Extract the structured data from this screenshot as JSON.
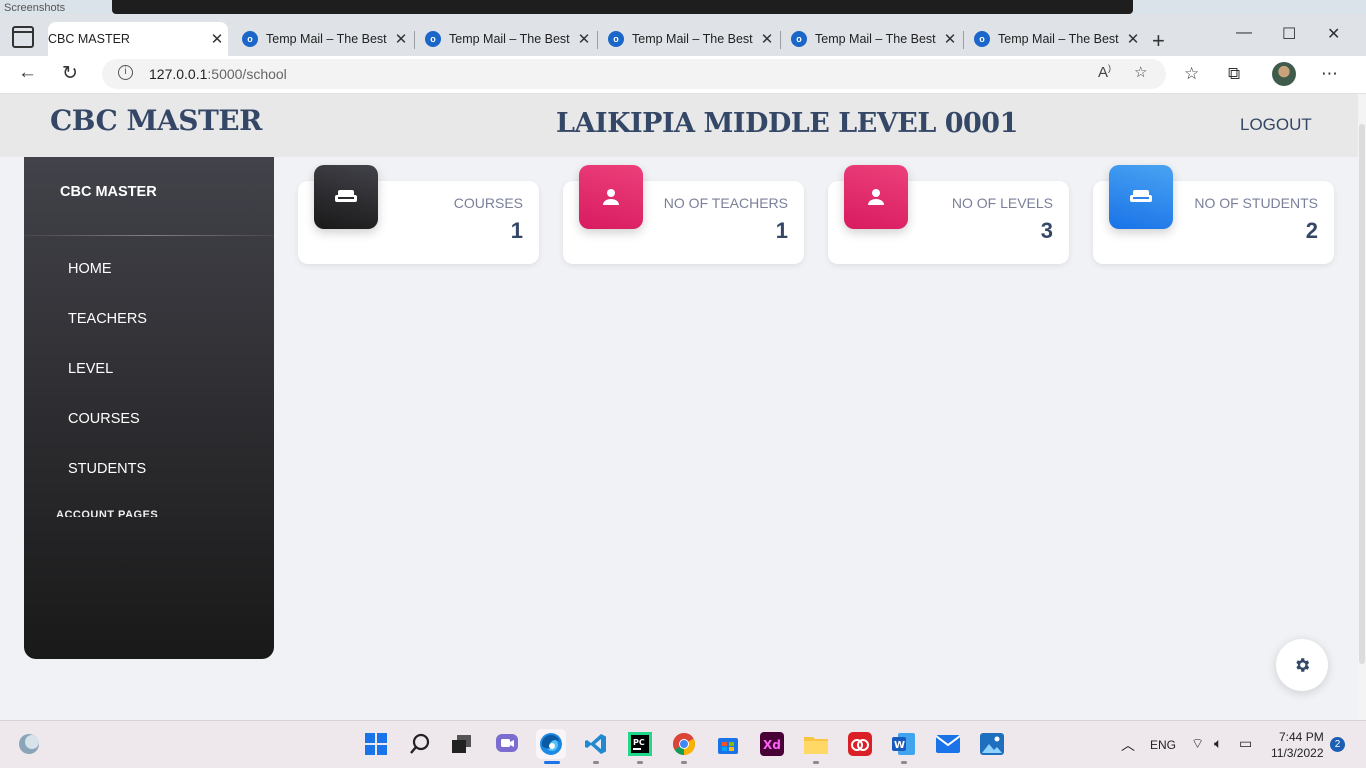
{
  "browser": {
    "tabs": [
      {
        "title": "CBC MASTER",
        "active": true
      },
      {
        "title": "Temp Mail – The Best",
        "active": false
      },
      {
        "title": "Temp Mail – The Best",
        "active": false
      },
      {
        "title": "Temp Mail – The Best",
        "active": false
      },
      {
        "title": "Temp Mail – The Best",
        "active": false
      },
      {
        "title": "Temp Mail – The Best",
        "active": false
      }
    ],
    "url_host": "127.0.0.1",
    "url_path": ":5000/school"
  },
  "header": {
    "brand": "CBC MASTER",
    "school_name": "LAIKIPIA MIDDLE LEVEL 0001",
    "logout": "LOGOUT"
  },
  "sidebar": {
    "brand": "CBC MASTER",
    "items": [
      {
        "label": "HOME"
      },
      {
        "label": "TEACHERS"
      },
      {
        "label": "LEVEL"
      },
      {
        "label": "COURSES"
      },
      {
        "label": "STUDENTS"
      }
    ],
    "section_label": "ACCOUNT PAGES"
  },
  "stats": [
    {
      "label": "COURSES",
      "value": "1",
      "icon": "weekend-icon",
      "color": "#191919"
    },
    {
      "label": "NO OF TEACHERS",
      "value": "1",
      "icon": "person-icon",
      "color": "#d81b60"
    },
    {
      "label": "NO OF LEVELS",
      "value": "3",
      "icon": "person-icon",
      "color": "#d81b60"
    },
    {
      "label": "NO OF STUDENTS",
      "value": "2",
      "icon": "weekend-icon",
      "color": "#1a73e8"
    }
  ],
  "taskbar": {
    "language": "ENG",
    "time": "7:44 PM",
    "date": "11/3/2022",
    "notifications": "2"
  },
  "background": {
    "folder_label": "Screenshots"
  }
}
